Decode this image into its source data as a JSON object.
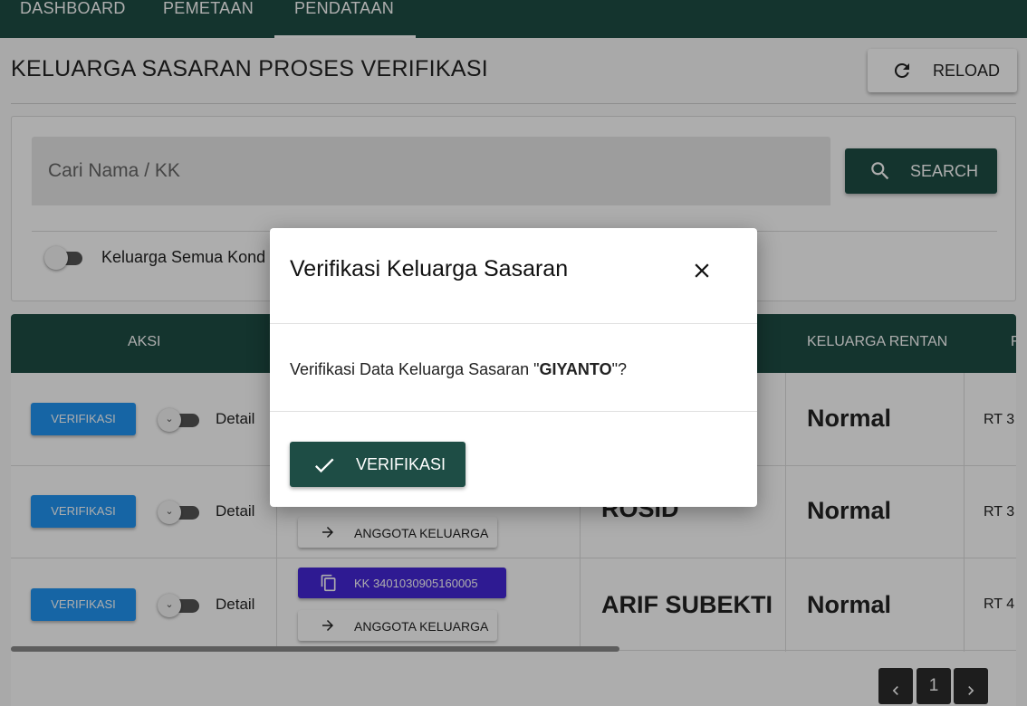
{
  "nav": {
    "tabs": [
      {
        "label": "DASHBOARD",
        "active": false
      },
      {
        "label": "PEMETAAN",
        "active": false
      },
      {
        "label": "PENDATAAN",
        "active": true
      }
    ]
  },
  "page": {
    "title": "KELUARGA SASARAN PROSES VERIFIKASI",
    "reload_label": "RELOAD",
    "reload_icon": "refresh-icon"
  },
  "search": {
    "placeholder": "Cari Nama / KK",
    "value": "",
    "button_label": "SEARCH",
    "button_icon": "search-icon",
    "filter_toggle_label": "Keluarga Semua Kond",
    "filter_toggle_on": false
  },
  "table": {
    "headers": {
      "aksi": "AKSI",
      "keluarga_rentan": "KELUARGA RENTAN",
      "next": "F"
    },
    "rows": [
      {
        "action_label": "VERIFIKASI",
        "toggle_glyph": "⌄",
        "detail_label": "Detail",
        "kk_label": "",
        "anggota_label": "",
        "name": "",
        "rentan": "Normal",
        "rt": "RT 3"
      },
      {
        "action_label": "VERIFIKASI",
        "toggle_glyph": "⌄",
        "detail_label": "Detail",
        "kk_label": "",
        "anggota_label": "ANGGOTA KELUARGA",
        "name": "ROSID",
        "rentan": "Normal",
        "rt": "RT 3"
      },
      {
        "action_label": "VERIFIKASI",
        "toggle_glyph": "⌄",
        "detail_label": "Detail",
        "kk_label": "KK 3401030905160005",
        "anggota_label": "ANGGOTA KELUARGA",
        "name": "ARIF SUBEKTI",
        "rentan": "Normal",
        "rt": "RT 4"
      }
    ]
  },
  "pagination": {
    "prev_icon": "chevron-left-icon",
    "current_page": "1",
    "next_icon": "chevron-right-icon"
  },
  "modal": {
    "title": "Verifikasi Keluarga Sasaran",
    "close_icon": "close-icon",
    "message_prefix": "Verifikasi Data Keluarga Sasaran \"",
    "message_name": "GIYANTO",
    "message_suffix": "\"?",
    "confirm_label": "VERIFIKASI",
    "confirm_icon": "check-icon"
  },
  "colors": {
    "primary_dark_green": "#1e4d45",
    "verify_blue": "#2196f3",
    "kk_purple": "#4527d8",
    "pager_dark": "#2b2b2b"
  }
}
